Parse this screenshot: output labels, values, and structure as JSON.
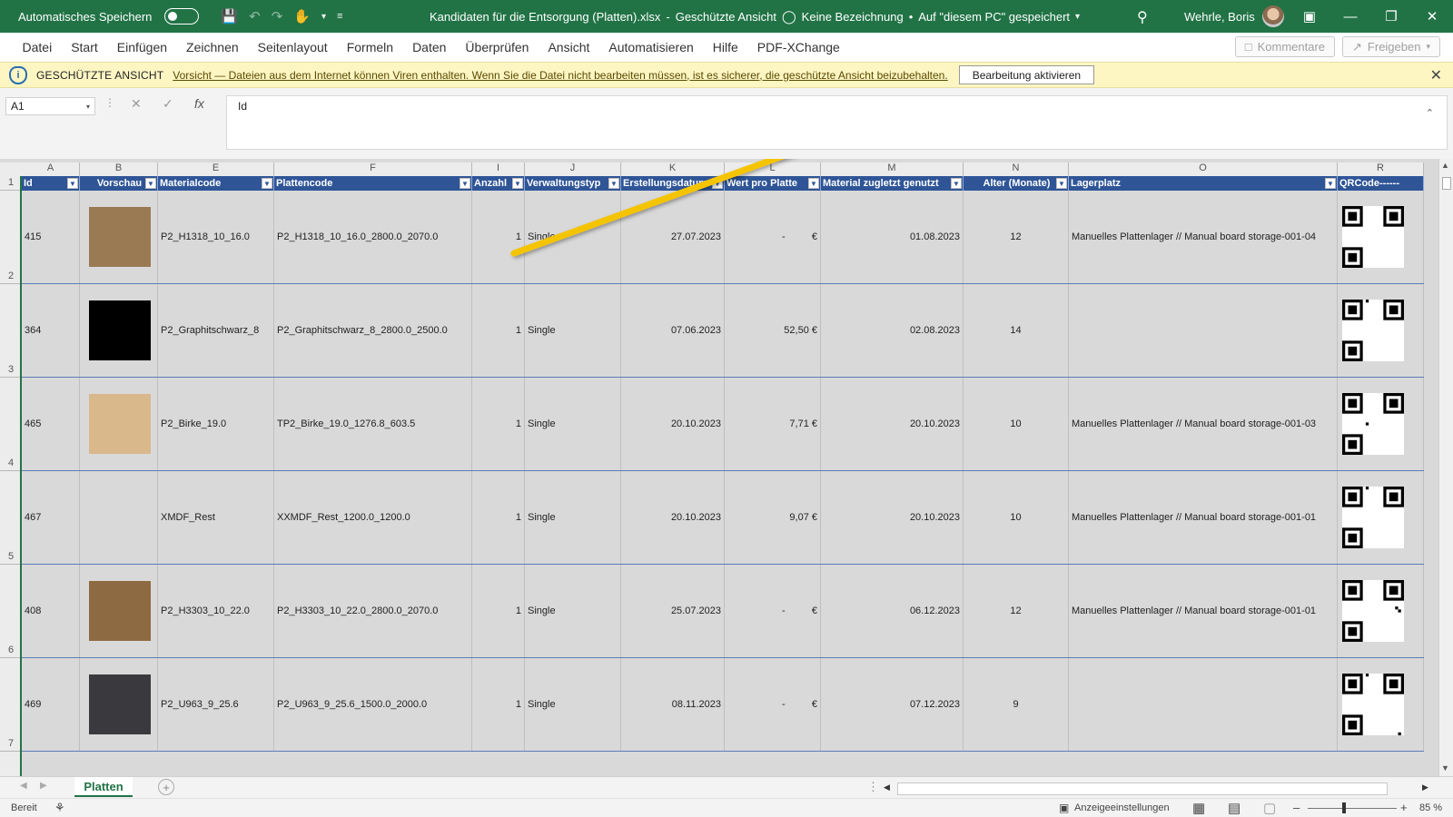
{
  "titlebar": {
    "autosave_label": "Automatisches Speichern",
    "filename": "Kandidaten für die Entsorgung (Platten).xlsx",
    "sep1": "-",
    "view_mode": "Geschützte Ansicht",
    "label_status": "Keine Bezeichnung",
    "bullet": "•",
    "save_location": "Auf \"diesem PC\" gespeichert",
    "user": "Wehrle, Boris"
  },
  "menu": {
    "items": [
      "Datei",
      "Start",
      "Einfügen",
      "Zeichnen",
      "Seitenlayout",
      "Formeln",
      "Daten",
      "Überprüfen",
      "Ansicht",
      "Automatisieren",
      "Hilfe",
      "PDF-XChange"
    ],
    "comments_label": "Kommentare",
    "share_label": "Freigeben"
  },
  "protected_bar": {
    "title": "GESCHÜTZTE ANSICHT",
    "message": "Vorsicht — Dateien aus dem Internet können Viren enthalten. Wenn Sie die Datei nicht bearbeiten müssen, ist es sicherer, die geschützte Ansicht beizubehalten.",
    "button": "Bearbeitung aktivieren"
  },
  "formula_bar": {
    "cell_ref": "A1",
    "content": "Id"
  },
  "sheet": {
    "column_letters": [
      "A",
      "B",
      "E",
      "F",
      "I",
      "J",
      "K",
      "L",
      "M",
      "N",
      "O",
      "R"
    ],
    "headers": [
      "Id",
      "Vorschau",
      "Materialcode",
      "Plattencode",
      "Anzahl",
      "Verwaltungstyp",
      "Erstellungsdatum",
      "Wert pro Platte",
      "Material zugletzt genutzt",
      "Alter (Monate)",
      "Lagerplatz",
      "QRCode------"
    ],
    "row_numbers": [
      "1",
      "2",
      "3",
      "4",
      "5",
      "6",
      "7"
    ],
    "rows": [
      {
        "id": "415",
        "swatch": "#9a7a52",
        "material": "P2_H1318_10_16.0",
        "plate": "P2_H1318_10_16.0_2800.0_2070.0",
        "count": "1",
        "type": "Single",
        "created": "27.07.2023",
        "value": "-",
        "currency": "€",
        "last_used": "01.08.2023",
        "age": "12",
        "location": "Manuelles Plattenlager // Manual board storage-001-04"
      },
      {
        "id": "364",
        "swatch": "#000000",
        "material": "P2_Graphitschwarz_8",
        "plate": "P2_Graphitschwarz_8_2800.0_2500.0",
        "count": "1",
        "type": "Single",
        "created": "07.06.2023",
        "value": "52,50 €",
        "currency": "",
        "last_used": "02.08.2023",
        "age": "14",
        "location": ""
      },
      {
        "id": "465",
        "swatch": "#d9b88c",
        "material": "P2_Birke_19.0",
        "plate": "TP2_Birke_19.0_1276.8_603.5",
        "count": "1",
        "type": "Single",
        "created": "20.10.2023",
        "value": "7,71 €",
        "currency": "",
        "last_used": "20.10.2023",
        "age": "10",
        "location": "Manuelles Plattenlager // Manual board storage-001-03"
      },
      {
        "id": "467",
        "swatch": "",
        "material": "XMDF_Rest",
        "plate": "XXMDF_Rest_1200.0_1200.0",
        "count": "1",
        "type": "Single",
        "created": "20.10.2023",
        "value": "9,07 €",
        "currency": "",
        "last_used": "20.10.2023",
        "age": "10",
        "location": "Manuelles Plattenlager // Manual board storage-001-01"
      },
      {
        "id": "408",
        "swatch": "#8e6a42",
        "material": "P2_H3303_10_22.0",
        "plate": "P2_H3303_10_22.0_2800.0_2070.0",
        "count": "1",
        "type": "Single",
        "created": "25.07.2023",
        "value": "-",
        "currency": "€",
        "last_used": "06.12.2023",
        "age": "12",
        "location": "Manuelles Plattenlager // Manual board storage-001-01"
      },
      {
        "id": "469",
        "swatch": "#3a3a3e",
        "material": "P2_U963_9_25.6",
        "plate": "P2_U963_9_25.6_1500.0_2000.0",
        "count": "1",
        "type": "Single",
        "created": "08.11.2023",
        "value": "-",
        "currency": "€",
        "last_used": "07.12.2023",
        "age": "9",
        "location": ""
      }
    ]
  },
  "sheet_tabs": [
    "Platten"
  ],
  "status": {
    "ready": "Bereit",
    "display_settings": "Anzeigeeinstellungen",
    "zoom": "85 %"
  },
  "colors": {
    "excel_green": "#217346",
    "table_header": "#2f5597",
    "warning_bar": "#fdf6c3",
    "annotation_arrow": "#f5c400"
  }
}
